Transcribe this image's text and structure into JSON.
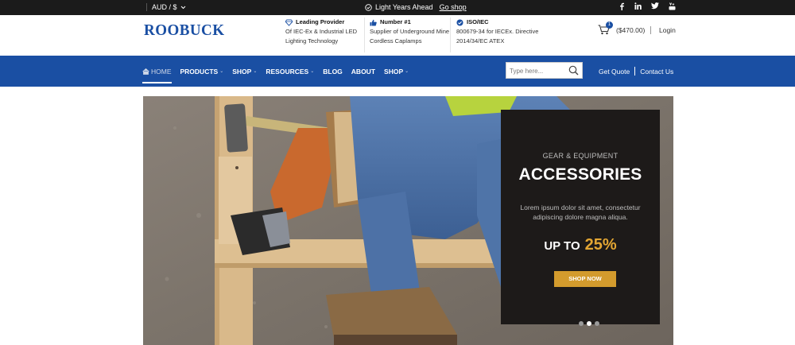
{
  "topbar": {
    "currency": "AUD / $",
    "promo_text": "Light Years Ahead",
    "promo_link": "Go shop",
    "social": [
      "f",
      "in",
      "tw",
      "yt"
    ]
  },
  "header": {
    "logo": "ROOBUCK",
    "features": [
      {
        "icon": "diamond-icon",
        "title": "Leading Provider",
        "line1": "Of IEC-Ex & Industrial LED",
        "line2": "Lighting Technology"
      },
      {
        "icon": "thumbs-up-icon",
        "title": "Number #1",
        "line1": "Supplier of Underground Mine",
        "line2": "Cordless Caplamps"
      },
      {
        "icon": "check-circle-icon",
        "title": "ISO/IEC",
        "line1": "800679-34 for IECEx. Directive",
        "line2": "2014/34/EC ATEX"
      }
    ],
    "cart_count": "1",
    "cart_total": "($470.00)",
    "login": "Login"
  },
  "nav": {
    "items": [
      {
        "label": "HOME",
        "active": true,
        "dropdown": false
      },
      {
        "label": "PRODUCTS",
        "active": false,
        "dropdown": true
      },
      {
        "label": "SHOP",
        "active": false,
        "dropdown": true
      },
      {
        "label": "RESOURCES",
        "active": false,
        "dropdown": true
      },
      {
        "label": "BLOG",
        "active": false,
        "dropdown": false
      },
      {
        "label": "ABOUT",
        "active": false,
        "dropdown": false
      },
      {
        "label": "SHOP",
        "active": false,
        "dropdown": true
      }
    ],
    "search_placeholder": "Type here...",
    "get_quote": "Get Quote",
    "contact": "Contact Us"
  },
  "hero": {
    "eyebrow": "GEAR & EQUIPMENT",
    "headline": "ACCESSORIES",
    "description": "Lorem ipsum dolor sit amet, consectetur adipiscing dolore magna aliqua.",
    "offer_prefix": "UP TO",
    "offer_value": "25%",
    "button": "SHOP NOW",
    "slides_count": 3,
    "active_slide": 2
  },
  "colors": {
    "brand_blue": "#1a4fa3",
    "accent_gold": "#e3a633",
    "button_gold": "#d39b2d",
    "topbar_bg": "#1b1b1b"
  }
}
